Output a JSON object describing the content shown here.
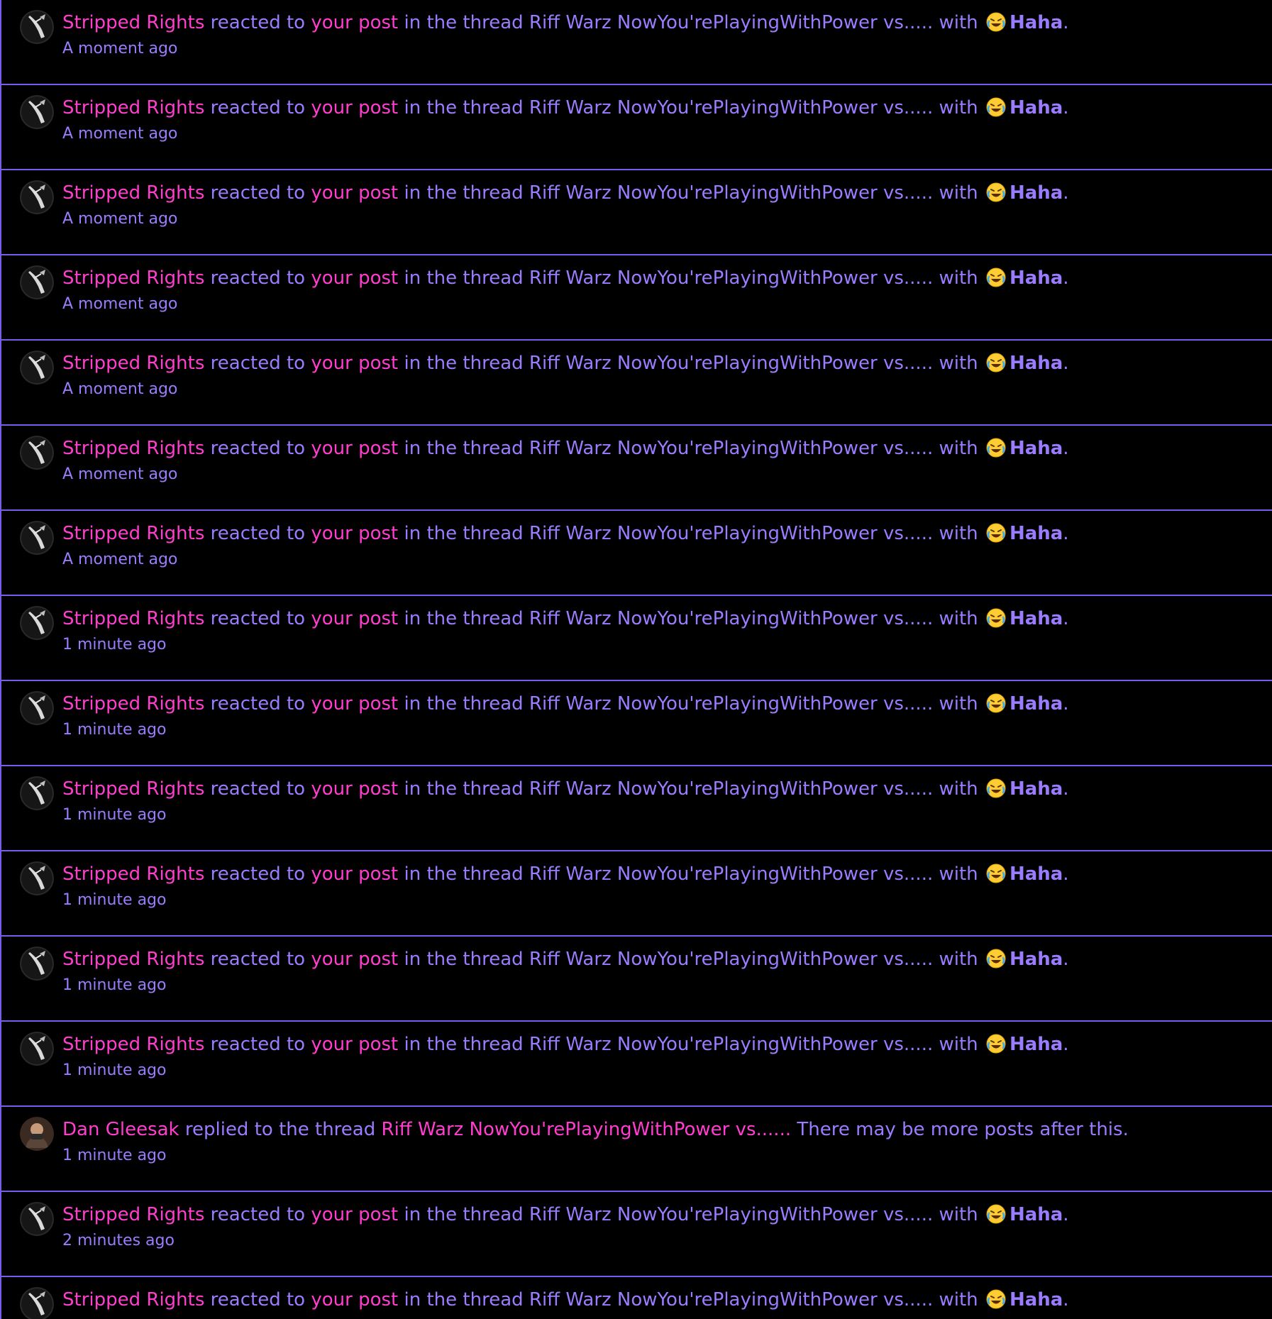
{
  "colors": {
    "background": "#000000",
    "divider": "#7a5cf0",
    "username": "#ff3ecf",
    "text": "#9b7cff"
  },
  "alerts": [
    {
      "type": "reaction",
      "user": "Stripped Rights",
      "reacted_text": "reacted to",
      "post_link": "your post",
      "in_thread_text": "in the thread",
      "thread": "Riff Warz NowYou'rePlayingWithPower vs.....",
      "with_text": "with",
      "reaction_icon": "rolling-laughing-emoji-icon",
      "reaction": "Haha",
      "end": ".",
      "time": "A moment ago"
    },
    {
      "type": "reaction",
      "user": "Stripped Rights",
      "reacted_text": "reacted to",
      "post_link": "your post",
      "in_thread_text": "in the thread",
      "thread": "Riff Warz NowYou'rePlayingWithPower vs.....",
      "with_text": "with",
      "reaction_icon": "rolling-laughing-emoji-icon",
      "reaction": "Haha",
      "end": ".",
      "time": "A moment ago"
    },
    {
      "type": "reaction",
      "user": "Stripped Rights",
      "reacted_text": "reacted to",
      "post_link": "your post",
      "in_thread_text": "in the thread",
      "thread": "Riff Warz NowYou'rePlayingWithPower vs.....",
      "with_text": "with",
      "reaction_icon": "rolling-laughing-emoji-icon",
      "reaction": "Haha",
      "end": ".",
      "time": "A moment ago"
    },
    {
      "type": "reaction",
      "user": "Stripped Rights",
      "reacted_text": "reacted to",
      "post_link": "your post",
      "in_thread_text": "in the thread",
      "thread": "Riff Warz NowYou'rePlayingWithPower vs.....",
      "with_text": "with",
      "reaction_icon": "rolling-laughing-emoji-icon",
      "reaction": "Haha",
      "end": ".",
      "time": "A moment ago"
    },
    {
      "type": "reaction",
      "user": "Stripped Rights",
      "reacted_text": "reacted to",
      "post_link": "your post",
      "in_thread_text": "in the thread",
      "thread": "Riff Warz NowYou'rePlayingWithPower vs.....",
      "with_text": "with",
      "reaction_icon": "rolling-laughing-emoji-icon",
      "reaction": "Haha",
      "end": ".",
      "time": "A moment ago"
    },
    {
      "type": "reaction",
      "user": "Stripped Rights",
      "reacted_text": "reacted to",
      "post_link": "your post",
      "in_thread_text": "in the thread",
      "thread": "Riff Warz NowYou'rePlayingWithPower vs.....",
      "with_text": "with",
      "reaction_icon": "rolling-laughing-emoji-icon",
      "reaction": "Haha",
      "end": ".",
      "time": "A moment ago"
    },
    {
      "type": "reaction",
      "user": "Stripped Rights",
      "reacted_text": "reacted to",
      "post_link": "your post",
      "in_thread_text": "in the thread",
      "thread": "Riff Warz NowYou'rePlayingWithPower vs.....",
      "with_text": "with",
      "reaction_icon": "rolling-laughing-emoji-icon",
      "reaction": "Haha",
      "end": ".",
      "time": "A moment ago"
    },
    {
      "type": "reaction",
      "user": "Stripped Rights",
      "reacted_text": "reacted to",
      "post_link": "your post",
      "in_thread_text": "in the thread",
      "thread": "Riff Warz NowYou'rePlayingWithPower vs.....",
      "with_text": "with",
      "reaction_icon": "rolling-laughing-emoji-icon",
      "reaction": "Haha",
      "end": ".",
      "time": "1 minute ago"
    },
    {
      "type": "reaction",
      "user": "Stripped Rights",
      "reacted_text": "reacted to",
      "post_link": "your post",
      "in_thread_text": "in the thread",
      "thread": "Riff Warz NowYou'rePlayingWithPower vs.....",
      "with_text": "with",
      "reaction_icon": "rolling-laughing-emoji-icon",
      "reaction": "Haha",
      "end": ".",
      "time": "1 minute ago"
    },
    {
      "type": "reaction",
      "user": "Stripped Rights",
      "reacted_text": "reacted to",
      "post_link": "your post",
      "in_thread_text": "in the thread",
      "thread": "Riff Warz NowYou'rePlayingWithPower vs.....",
      "with_text": "with",
      "reaction_icon": "rolling-laughing-emoji-icon",
      "reaction": "Haha",
      "end": ".",
      "time": "1 minute ago"
    },
    {
      "type": "reaction",
      "user": "Stripped Rights",
      "reacted_text": "reacted to",
      "post_link": "your post",
      "in_thread_text": "in the thread",
      "thread": "Riff Warz NowYou'rePlayingWithPower vs.....",
      "with_text": "with",
      "reaction_icon": "rolling-laughing-emoji-icon",
      "reaction": "Haha",
      "end": ".",
      "time": "1 minute ago"
    },
    {
      "type": "reaction",
      "user": "Stripped Rights",
      "reacted_text": "reacted to",
      "post_link": "your post",
      "in_thread_text": "in the thread",
      "thread": "Riff Warz NowYou'rePlayingWithPower vs.....",
      "with_text": "with",
      "reaction_icon": "rolling-laughing-emoji-icon",
      "reaction": "Haha",
      "end": ".",
      "time": "1 minute ago"
    },
    {
      "type": "reaction",
      "user": "Stripped Rights",
      "reacted_text": "reacted to",
      "post_link": "your post",
      "in_thread_text": "in the thread",
      "thread": "Riff Warz NowYou'rePlayingWithPower vs.....",
      "with_text": "with",
      "reaction_icon": "rolling-laughing-emoji-icon",
      "reaction": "Haha",
      "end": ".",
      "time": "1 minute ago"
    },
    {
      "type": "reply",
      "user": "Dan Gleesak",
      "replied_text": "replied to the thread",
      "thread": "Riff Warz NowYou'rePlayingWithPower vs......",
      "tail_text": "There may be more posts after this.",
      "time": "1 minute ago"
    },
    {
      "type": "reaction",
      "user": "Stripped Rights",
      "reacted_text": "reacted to",
      "post_link": "your post",
      "in_thread_text": "in the thread",
      "thread": "Riff Warz NowYou'rePlayingWithPower vs.....",
      "with_text": "with",
      "reaction_icon": "rolling-laughing-emoji-icon",
      "reaction": "Haha",
      "end": ".",
      "time": "2 minutes ago"
    },
    {
      "type": "reaction",
      "user": "Stripped Rights",
      "reacted_text": "reacted to",
      "post_link": "your post",
      "in_thread_text": "in the thread",
      "thread": "Riff Warz NowYou'rePlayingWithPower vs.....",
      "with_text": "with",
      "reaction_icon": "rolling-laughing-emoji-icon",
      "reaction": "Haha",
      "end": ".",
      "time": ""
    }
  ]
}
